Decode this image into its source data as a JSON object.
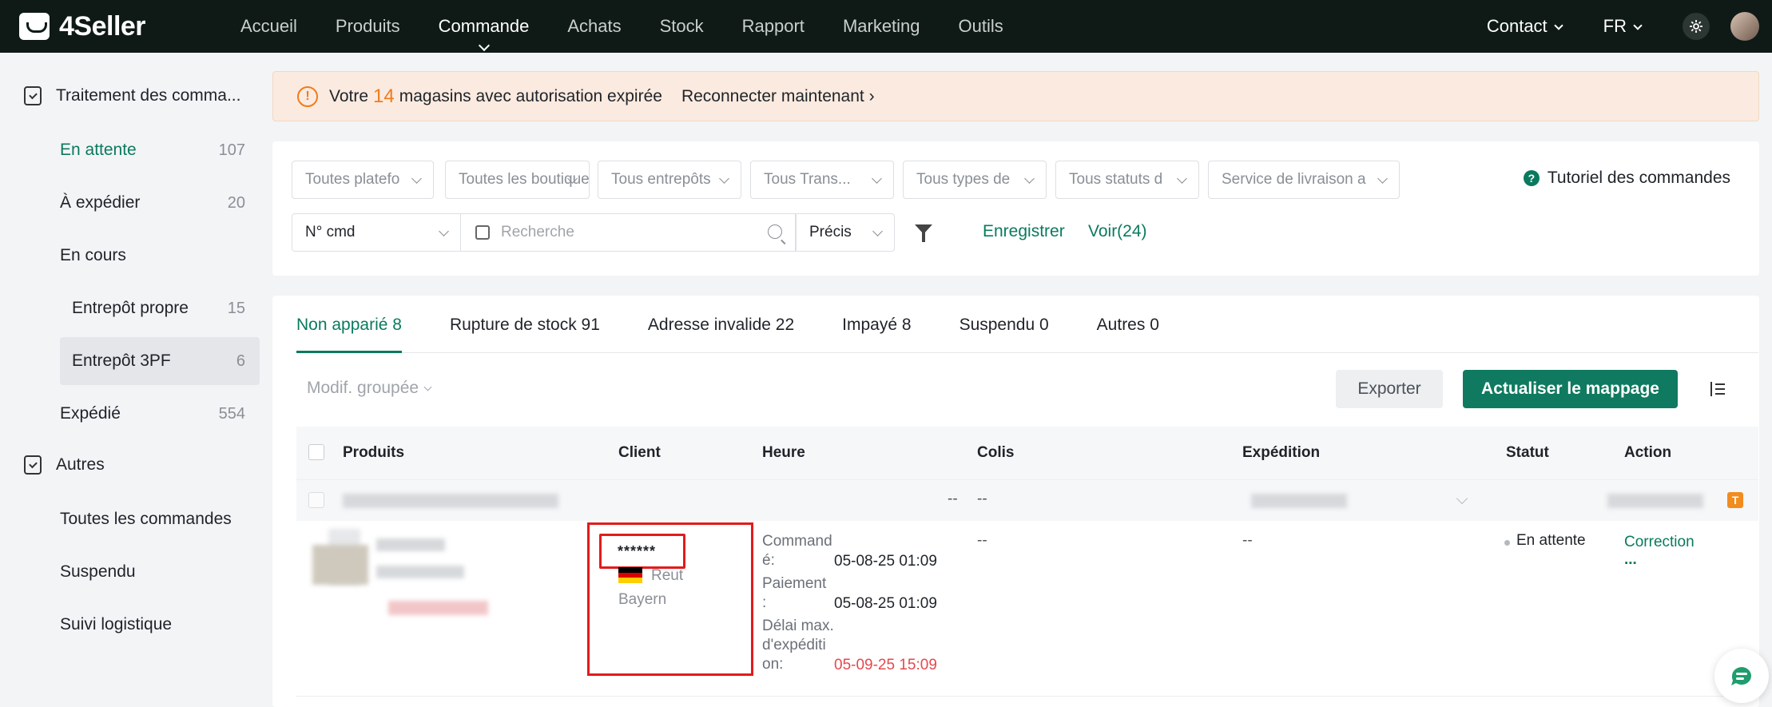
{
  "app": {
    "logo_text": "4Seller"
  },
  "nav": {
    "items": [
      "Accueil",
      "Produits",
      "Commande",
      "Achats",
      "Stock",
      "Rapport",
      "Marketing",
      "Outils"
    ],
    "active": "Commande",
    "contact": "Contact",
    "lang": "FR"
  },
  "sidebar": {
    "group1": "Traitement des comma...",
    "items": [
      {
        "label": "En attente",
        "count": "107"
      },
      {
        "label": "À expédier",
        "count": "20"
      },
      {
        "label": "En cours",
        "count": ""
      },
      {
        "label": "Entrepôt propre",
        "count": "15"
      },
      {
        "label": "Entrepôt 3PF",
        "count": "6"
      },
      {
        "label": "Expédié",
        "count": "554"
      }
    ],
    "group2": "Autres",
    "others": [
      "Toutes les commandes",
      "Suspendu",
      "Suivi logistique"
    ]
  },
  "banner": {
    "prefix": "Votre",
    "count": "14",
    "suffix": "magasins avec autorisation expirée",
    "link": "Reconnecter maintenant"
  },
  "filters": {
    "row1": [
      "Toutes platefo",
      "Toutes les boutiques",
      "Tous entrepôts",
      "Tous Trans...",
      "Tous types de",
      "Tous statuts d",
      "Service de livraison a"
    ],
    "tutorial": "Tutoriel des commandes",
    "field_select": "N° cmd",
    "search_placeholder": "Recherche",
    "match_select": "Précis",
    "save": "Enregistrer",
    "view": "Voir(24)"
  },
  "tabs": [
    "Non apparié 8",
    "Rupture de stock 91",
    "Adresse invalide 22",
    "Impayé 8",
    "Suspendu 0",
    "Autres 0"
  ],
  "toolbar": {
    "bulk_edit": "Modif. groupée",
    "export": "Exporter",
    "refresh_mapping": "Actualiser le mappage"
  },
  "table": {
    "columns": [
      "Produits",
      "Client",
      "Heure",
      "Colis",
      "Expédition",
      "Statut",
      "Action"
    ],
    "group_row": {
      "heure": "--",
      "colis": "--"
    },
    "row": {
      "client_name": "******",
      "client_city": "Reut",
      "client_region": "Bayern",
      "commande_label_1": "Command",
      "commande_label_2": "é:",
      "commande_value": "05-08-25 01:09",
      "paiement_label_1": "Paiement",
      "paiement_label_2": ":",
      "paiement_value": "05-08-25 01:09",
      "delai_label_1": "Délai max.",
      "delai_label_2": "d'expéditi",
      "delai_label_3": "on:",
      "delai_value": "05-09-25 15:09",
      "colis": "--",
      "expedition": "--",
      "statut": "En attente",
      "action": "Correction",
      "action_more": "..."
    }
  },
  "colors": {
    "accent": "#0a7a5e",
    "warning": "#f07c1b",
    "highlight": "#e21b1b"
  }
}
